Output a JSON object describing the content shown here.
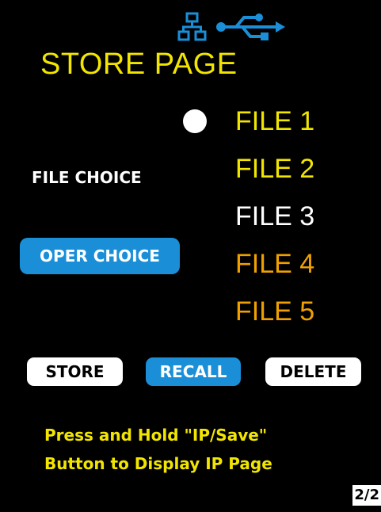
{
  "status_icons": [
    "network-icon",
    "usb-icon"
  ],
  "header": {
    "title": "STORE PAGE"
  },
  "left_panel": {
    "file_choice_label": "FILE CHOICE",
    "oper_choice_label": "OPER CHOICE",
    "highlighted": "OPER CHOICE"
  },
  "files": [
    {
      "label": "FILE 1",
      "color": "#f2e600",
      "selected": true
    },
    {
      "label": "FILE 2",
      "color": "#f2e600",
      "selected": false
    },
    {
      "label": "FILE 3",
      "color": "#ffffff",
      "selected": false
    },
    {
      "label": "FILE 4",
      "color": "#f0a000",
      "selected": false
    },
    {
      "label": "FILE 5",
      "color": "#f0a000",
      "selected": false
    }
  ],
  "actions": {
    "store_label": "STORE",
    "recall_label": "RECALL",
    "delete_label": "DELETE",
    "active": "RECALL"
  },
  "hint": {
    "line1": "Press and Hold \"IP/Save\"",
    "line2": "Button to Display IP Page"
  },
  "page_indicator": "2/2",
  "colors": {
    "background": "#000000",
    "title": "#f2e600",
    "accent": "#1a8fd8",
    "hint": "#f2e600",
    "file_white": "#ffffff",
    "file_yellow": "#f2e600",
    "file_orange": "#f0a000"
  }
}
